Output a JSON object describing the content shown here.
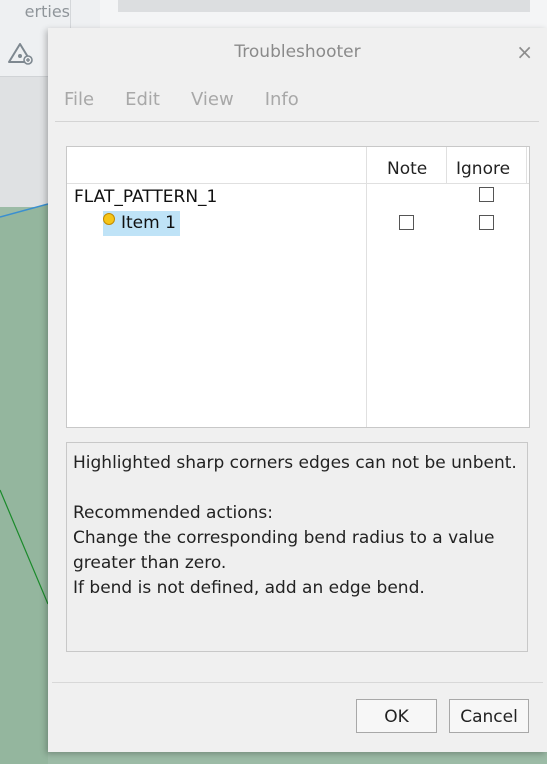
{
  "background": {
    "tab_text": "erties"
  },
  "dialog": {
    "title": "Troubleshooter",
    "close_glyph": "×",
    "menu": [
      "File",
      "Edit",
      "View",
      "Info"
    ],
    "tree": {
      "columns": [
        "Note",
        "Ignore"
      ],
      "root_label": "FLAT_PATTERN_1",
      "item_label": "Item 1",
      "root_checks": {
        "note": null,
        "ignore": false
      },
      "item_checks": {
        "note": false,
        "ignore": false
      }
    },
    "message": {
      "line1": "Highlighted sharp corners edges can not be unbent.",
      "line2": "Recommended actions:",
      "line3": "Change the corresponding bend radius to a value greater than zero.",
      "line4": "If bend is not defined, add an edge bend."
    },
    "buttons": {
      "ok": "OK",
      "cancel": "Cancel"
    }
  },
  "icons": {
    "side_tool": "triangle-gear-icon",
    "item_status": "yellow-bulb-icon"
  },
  "colors": {
    "model_green": "#94b69e",
    "selection": "#bfe3f7"
  }
}
